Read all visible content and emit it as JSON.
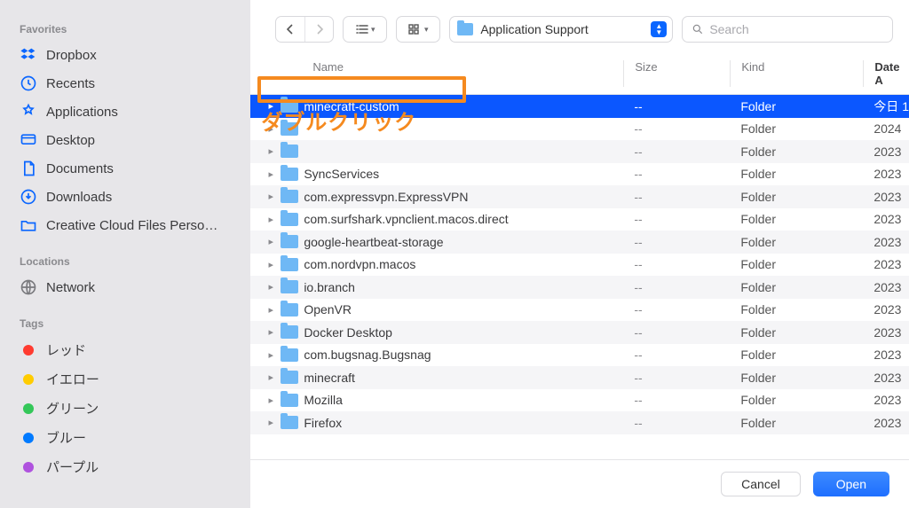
{
  "sidebar": {
    "sections": [
      {
        "title": "Favorites",
        "items": [
          {
            "icon": "dropbox",
            "label": "Dropbox",
            "color": "#0a66ff"
          },
          {
            "icon": "clock",
            "label": "Recents",
            "color": "#0a66ff"
          },
          {
            "icon": "apps",
            "label": "Applications",
            "color": "#0a66ff"
          },
          {
            "icon": "desktop",
            "label": "Desktop",
            "color": "#0a66ff"
          },
          {
            "icon": "doc",
            "label": "Documents",
            "color": "#0a66ff"
          },
          {
            "icon": "download",
            "label": "Downloads",
            "color": "#0a66ff"
          },
          {
            "icon": "folder",
            "label": "Creative Cloud Files Perso…",
            "color": "#0a66ff"
          }
        ]
      },
      {
        "title": "Locations",
        "items": [
          {
            "icon": "globe",
            "label": "Network",
            "color": "#7a7a7e"
          }
        ]
      },
      {
        "title": "Tags",
        "items": [
          {
            "icon": "dot",
            "label": "レッド",
            "color": "#ff3b30"
          },
          {
            "icon": "dot",
            "label": "イエロー",
            "color": "#ffcc00"
          },
          {
            "icon": "dot",
            "label": "グリーン",
            "color": "#34c759"
          },
          {
            "icon": "dot",
            "label": "ブルー",
            "color": "#007aff"
          },
          {
            "icon": "dot",
            "label": "パープル",
            "color": "#af52de"
          }
        ]
      }
    ]
  },
  "toolbar": {
    "path_label": "Application Support",
    "search_placeholder": "Search"
  },
  "columns": {
    "name": "Name",
    "size": "Size",
    "kind": "Kind",
    "date": "Date A"
  },
  "rows": [
    {
      "name": "minecraft-custom",
      "size": "--",
      "kind": "Folder",
      "date": "今日 1",
      "selected": true
    },
    {
      "name": "",
      "size": "--",
      "kind": "Folder",
      "date": "2024",
      "selected": false
    },
    {
      "name": "",
      "size": "--",
      "kind": "Folder",
      "date": "2023",
      "selected": false
    },
    {
      "name": "SyncServices",
      "size": "--",
      "kind": "Folder",
      "date": "2023",
      "selected": false
    },
    {
      "name": "com.expressvpn.ExpressVPN",
      "size": "--",
      "kind": "Folder",
      "date": "2023",
      "selected": false
    },
    {
      "name": "com.surfshark.vpnclient.macos.direct",
      "size": "--",
      "kind": "Folder",
      "date": "2023",
      "selected": false
    },
    {
      "name": "google-heartbeat-storage",
      "size": "--",
      "kind": "Folder",
      "date": "2023",
      "selected": false
    },
    {
      "name": "com.nordvpn.macos",
      "size": "--",
      "kind": "Folder",
      "date": "2023",
      "selected": false
    },
    {
      "name": "io.branch",
      "size": "--",
      "kind": "Folder",
      "date": "2023",
      "selected": false
    },
    {
      "name": "OpenVR",
      "size": "--",
      "kind": "Folder",
      "date": "2023",
      "selected": false
    },
    {
      "name": "Docker Desktop",
      "size": "--",
      "kind": "Folder",
      "date": "2023",
      "selected": false
    },
    {
      "name": "com.bugsnag.Bugsnag",
      "size": "--",
      "kind": "Folder",
      "date": "2023",
      "selected": false
    },
    {
      "name": "minecraft",
      "size": "--",
      "kind": "Folder",
      "date": "2023",
      "selected": false
    },
    {
      "name": "Mozilla",
      "size": "--",
      "kind": "Folder",
      "date": "2023",
      "selected": false
    },
    {
      "name": "Firefox",
      "size": "--",
      "kind": "Folder",
      "date": "2023",
      "selected": false
    }
  ],
  "footer": {
    "cancel": "Cancel",
    "open": "Open"
  },
  "annotation": {
    "text": "ダブルクリック"
  }
}
